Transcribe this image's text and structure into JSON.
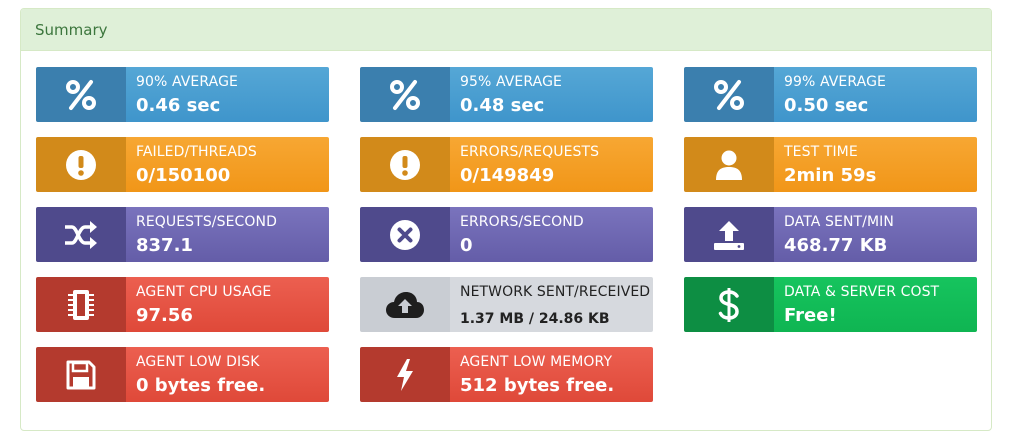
{
  "panel": {
    "title": "Summary"
  },
  "tiles": {
    "avg90": {
      "label": "90% AVERAGE",
      "value": "0.46 sec",
      "icon": "percent-icon"
    },
    "avg95": {
      "label": "95% AVERAGE",
      "value": "0.48 sec",
      "icon": "percent-icon"
    },
    "avg99": {
      "label": "99% AVERAGE",
      "value": "0.50 sec",
      "icon": "percent-icon"
    },
    "failed": {
      "label": "FAILED/THREADS",
      "value": "0/150100",
      "icon": "exclamation-icon"
    },
    "errors": {
      "label": "ERRORS/REQUESTS",
      "value": "0/149849",
      "icon": "exclamation-icon"
    },
    "testtime": {
      "label": "TEST TIME",
      "value": "2min 59s",
      "icon": "user-icon"
    },
    "rps": {
      "label": "REQUESTS/SECOND",
      "value": "837.1",
      "icon": "shuffle-icon"
    },
    "eps": {
      "label": "ERRORS/SECOND",
      "value": "0",
      "icon": "times-circle-icon"
    },
    "datasent": {
      "label": "DATA SENT/MIN",
      "value": "468.77 KB",
      "icon": "upload-icon"
    },
    "cpu": {
      "label": "AGENT CPU USAGE",
      "value": "97.56",
      "icon": "chip-icon"
    },
    "network": {
      "label": "NETWORK SENT/RECEIVED",
      "value": "1.37 MB / 24.86 KB",
      "icon": "cloud-upload-icon"
    },
    "cost": {
      "label": "DATA & SERVER COST",
      "value": "Free!",
      "icon": "dollar-icon"
    },
    "disk": {
      "label": "AGENT LOW DISK",
      "value": "0 bytes free.",
      "icon": "floppy-disk-icon"
    },
    "memory": {
      "label": "AGENT LOW MEMORY",
      "value": "512 bytes free.",
      "icon": "bolt-icon"
    }
  },
  "colors": {
    "blue": "#3f95cb",
    "orange": "#f19618",
    "purple": "#645da8",
    "red": "#df4939",
    "green": "#0fb552",
    "gray": "#d6d9de"
  }
}
